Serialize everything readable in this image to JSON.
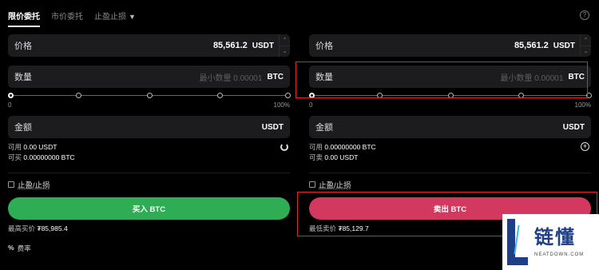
{
  "tabs": {
    "limit": "限价委托",
    "market": "市价委托",
    "tpsl": "止盈止损"
  },
  "buy": {
    "price_label": "价格",
    "price_value": "85,561.2",
    "price_unit": "USDT",
    "qty_label": "数量",
    "qty_placeholder": "最小数量 0.00001",
    "qty_unit": "BTC",
    "slider_min": "0",
    "slider_max": "100%",
    "amount_label": "金额",
    "amount_unit": "USDT",
    "avail_label": "可用",
    "avail_value": "0.00 USDT",
    "can_label": "可买",
    "can_value": "0.00000000 BTC",
    "tpsl_label": "止盈/止损",
    "button": "买入 BTC",
    "best_label": "最高买价",
    "best_value": "₮85,985.4"
  },
  "sell": {
    "price_label": "价格",
    "price_value": "85,561.2",
    "price_unit": "USDT",
    "qty_label": "数量",
    "qty_placeholder": "最小数量 0.00001",
    "qty_unit": "BTC",
    "slider_min": "0",
    "slider_max": "100%",
    "amount_label": "金额",
    "amount_unit": "USDT",
    "avail_label": "可用",
    "avail_value": "0.00000000 BTC",
    "can_label": "可卖",
    "can_value": "0.00 USDT",
    "tpsl_label": "止盈/止损",
    "button": "卖出 BTC",
    "best_label": "最低卖价",
    "best_value": "₮85,129.7"
  },
  "fee_label": "费率",
  "logo": {
    "cn": "链懂",
    "en": "NEATDOWN.COM"
  },
  "colors": {
    "buy": "#2ead55",
    "sell": "#d3385f",
    "highlight": "#e0262c",
    "field_bg": "#1c1c1e"
  }
}
